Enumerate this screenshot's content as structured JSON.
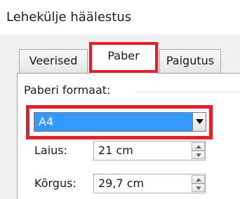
{
  "dialog": {
    "title": "Lehekülje häälestus"
  },
  "tabs": [
    {
      "label": "Veerised",
      "selected": false
    },
    {
      "label": "Paber",
      "selected": true
    },
    {
      "label": "Paigutus",
      "selected": false
    }
  ],
  "paper": {
    "group_label": "Paberi formaat:",
    "size_selected": "A4",
    "width_label": "Laius:",
    "width_value": "21 cm",
    "height_label": "Kõrgus:",
    "height_value": "29,7 cm"
  },
  "colors": {
    "highlight": "#e41e2b",
    "selection": "#3399ff"
  },
  "icons": {
    "dropdown": "triangle-down-icon",
    "spin_up": "spin-up-arrow-icon",
    "spin_down": "spin-down-arrow-icon"
  }
}
